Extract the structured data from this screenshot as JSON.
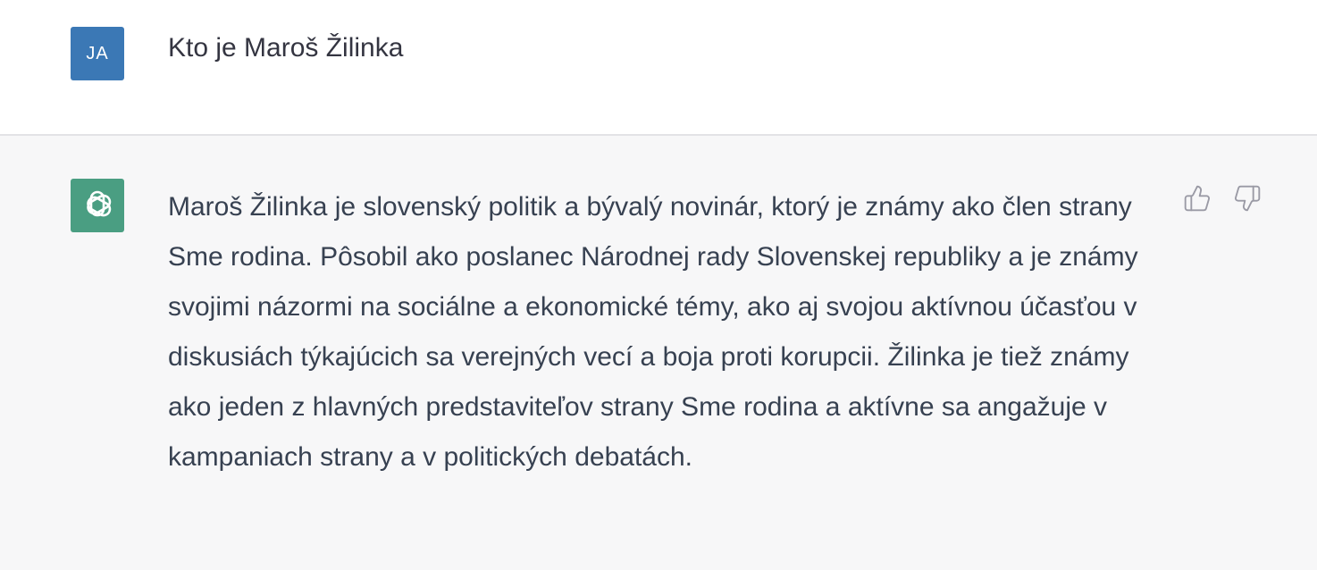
{
  "user_message": {
    "avatar_initials": "JA",
    "avatar_color": "#3b78b5",
    "text": "Kto je Maroš Žilinka"
  },
  "assistant_message": {
    "avatar_icon": "openai-logo-icon",
    "avatar_color": "#4a9e82",
    "text": "Maroš Žilinka je slovenský politik a bývalý novinár, ktorý je známy ako člen strany Sme rodina. Pôsobil ako poslanec Národnej rady Slovenskej republiky a je známy svojimi názormi na sociálne a ekonomické témy, ako aj svojou aktívnou účasťou v diskusiách týkajúcich sa verejných vecí a boja proti korupcii. Žilinka je tiež známy ako jeden z hlavných predstaviteľov strany Sme rodina a aktívne sa angažuje v kampaniach strany a v politických debatách."
  },
  "feedback": {
    "thumbs_up_icon": "thumbs-up-icon",
    "thumbs_down_icon": "thumbs-down-icon"
  }
}
